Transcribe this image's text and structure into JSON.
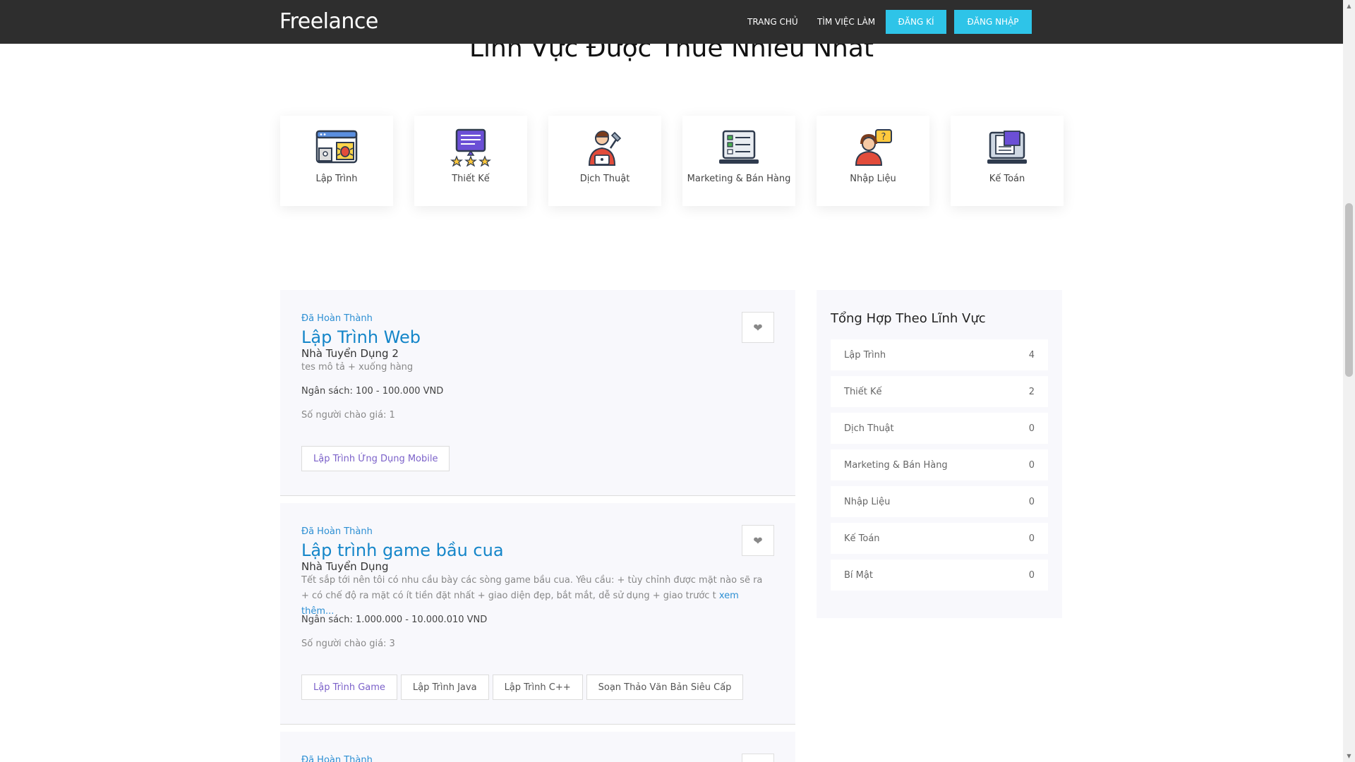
{
  "header": {
    "brand": "Freelance",
    "nav": {
      "home": "TRANG CHỦ",
      "find_jobs": "TÌM VIỆC LÀM",
      "register": "ĐĂNG KÍ",
      "login": "ĐĂNG NHẬP"
    }
  },
  "categories_section": {
    "title": "Lĩnh Vực Được Thuê Nhiều Nhất",
    "items": [
      {
        "label": "Lập Trình",
        "icon": "code-bug-icon"
      },
      {
        "label": "Thiết Kế",
        "icon": "design-rating-icon"
      },
      {
        "label": "Dịch Thuật",
        "icon": "translator-person-icon"
      },
      {
        "label": "Marketing & Bán Hàng",
        "icon": "checklist-laptop-icon"
      },
      {
        "label": "Nhập Liệu",
        "icon": "support-person-icon"
      },
      {
        "label": "Kế Toán",
        "icon": "accounting-laptop-icon"
      }
    ]
  },
  "jobs": [
    {
      "status": "Đã Hoàn Thành",
      "title": "Lập Trình Web",
      "company": "Nhà Tuyển Dụng 2",
      "description": "tes mô tả + xuống hàng",
      "more": "",
      "budget": "Ngân sách: 100 - 100.000 VND",
      "bids": "Số người chào giá: 1",
      "tags": [
        "Lập Trình Ứng Dụng Mobile"
      ]
    },
    {
      "status": "Đã Hoàn Thành",
      "title": "Lập trình game bầu cua",
      "company": "Nhà Tuyển Dụng",
      "description": "Tết sắp tới nên tôi có nhu cầu bày các sòng game bầu cua. Yêu cầu: + tùy chỉnh được mặt nào sẽ ra + có chế độ ra mặt có ít tiền đặt nhất + giao diện đẹp, bắt mắt, dễ sử dụng + giao trước t",
      "more": "xem thêm...",
      "budget": "Ngân sách: 1.000.000 - 10.000.010 VND",
      "bids": "Số người chào giá: 3",
      "tags": [
        "Lập Trình Game",
        "Lập Trình Java",
        "Lập Trình C++",
        "Soạn Thảo Văn Bản Siêu Cấp"
      ]
    },
    {
      "status": "Đã Hoàn Thành"
    }
  ],
  "sidebar": {
    "title": "Tổng Hợp Theo Lĩnh Vực",
    "items": [
      {
        "label": "Lập Trình",
        "count": "4"
      },
      {
        "label": "Thiết Kế",
        "count": "2"
      },
      {
        "label": "Dịch Thuật",
        "count": "0"
      },
      {
        "label": "Marketing & Bán Hàng",
        "count": "0"
      },
      {
        "label": "Nhập Liệu",
        "count": "0"
      },
      {
        "label": "Kế Toán",
        "count": "0"
      },
      {
        "label": "Bí Mật",
        "count": "0"
      }
    ]
  },
  "colors": {
    "header_bg": "#2e2e2e",
    "button_bg": "#2ec4e8",
    "title_blue": "#1586c9",
    "status_blue": "#2d8fd3",
    "panel_bg": "#f8f8fc"
  }
}
